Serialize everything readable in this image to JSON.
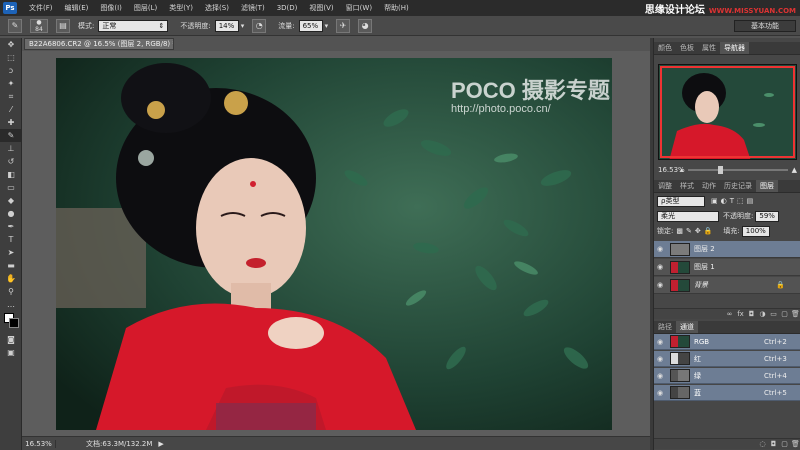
{
  "app": {
    "logo": "Ps"
  },
  "menu": [
    "文件(F)",
    "编辑(E)",
    "图像(I)",
    "图层(L)",
    "类型(Y)",
    "选择(S)",
    "滤镜(T)",
    "3D(D)",
    "视图(V)",
    "窗口(W)",
    "帮助(H)"
  ],
  "brand": {
    "title": "思缘设计论坛",
    "url": "WWW.MISSYUAN.COM"
  },
  "options": {
    "brush_size": "84",
    "mode_label": "模式:",
    "mode_value": "正常",
    "opacity_label": "不透明度:",
    "opacity_value": "14%",
    "flow_label": "流量:",
    "flow_value": "65%",
    "workspace": "基本功能"
  },
  "document": {
    "tab_title": "B22A6806.CR2 @ 16.5% (图层 2, RGB/8) *",
    "close": "×",
    "watermark_logo": "POCO 摄影专题",
    "watermark_url": "http://photo.poco.cn/"
  },
  "status": {
    "zoom": "16.53%",
    "doc": "文档:63.3M/132.2M",
    "arrow": "▶"
  },
  "navigator": {
    "tabs": [
      "颜色",
      "色板",
      "属性",
      "导航器"
    ],
    "active_tab": 3,
    "zoom": "16.53%"
  },
  "layers_panel": {
    "tabs": [
      "调整",
      "样式",
      "动作",
      "历史记录",
      "图层"
    ],
    "active_tab": 4,
    "filter_label": "ρ类型",
    "blend_mode": "柔光",
    "opacity_label": "不透明度:",
    "opacity_value": "59%",
    "lock_label": "锁定:",
    "fill_label": "填充:",
    "fill_value": "100%",
    "layers": [
      {
        "name": "图层 2",
        "selected": true
      },
      {
        "name": "图层 1",
        "selected": false
      },
      {
        "name": "背景",
        "selected": false,
        "locked": true
      }
    ]
  },
  "channels_panel": {
    "tabs": [
      "路径",
      "通道"
    ],
    "active_tab": 1,
    "channels": [
      {
        "name": "RGB",
        "shortcut": "Ctrl+2"
      },
      {
        "name": "红",
        "shortcut": "Ctrl+3"
      },
      {
        "name": "绿",
        "shortcut": "Ctrl+4"
      },
      {
        "name": "蓝",
        "shortcut": "Ctrl+5"
      }
    ]
  },
  "colors": {
    "selected_layer": "#6d7d94",
    "canvas_bg": "#5d5d5d",
    "ui_dark": "#2b2b2b"
  }
}
